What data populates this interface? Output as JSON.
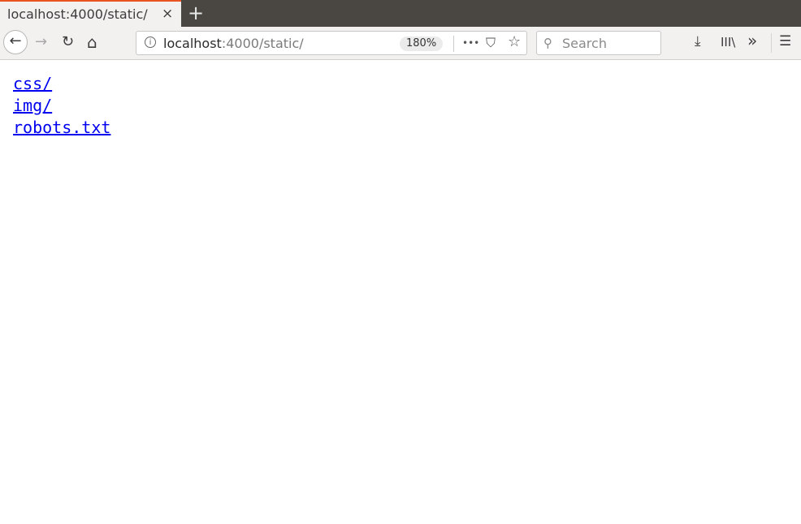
{
  "tab": {
    "title": "localhost:4000/static/",
    "close_icon": "×",
    "new_tab_icon": "+"
  },
  "nav": {
    "back_icon": "←",
    "forward_icon": "→",
    "reload_icon": "↻",
    "home_icon": "⌂"
  },
  "urlbar": {
    "info_icon": "i",
    "host": "localhost",
    "rest": ":4000/static/",
    "zoom": "180%",
    "more_icon": "•••",
    "pocket_icon": "⛉",
    "star_icon": "☆"
  },
  "search": {
    "icon": "⚲",
    "placeholder": "Search"
  },
  "toolbar": {
    "download_icon": "⤓",
    "library_icon": "III\\",
    "overflow_icon": "»",
    "menu_icon": "☰"
  },
  "listing": [
    {
      "label": "css/"
    },
    {
      "label": "img/"
    },
    {
      "label": "robots.txt"
    }
  ]
}
